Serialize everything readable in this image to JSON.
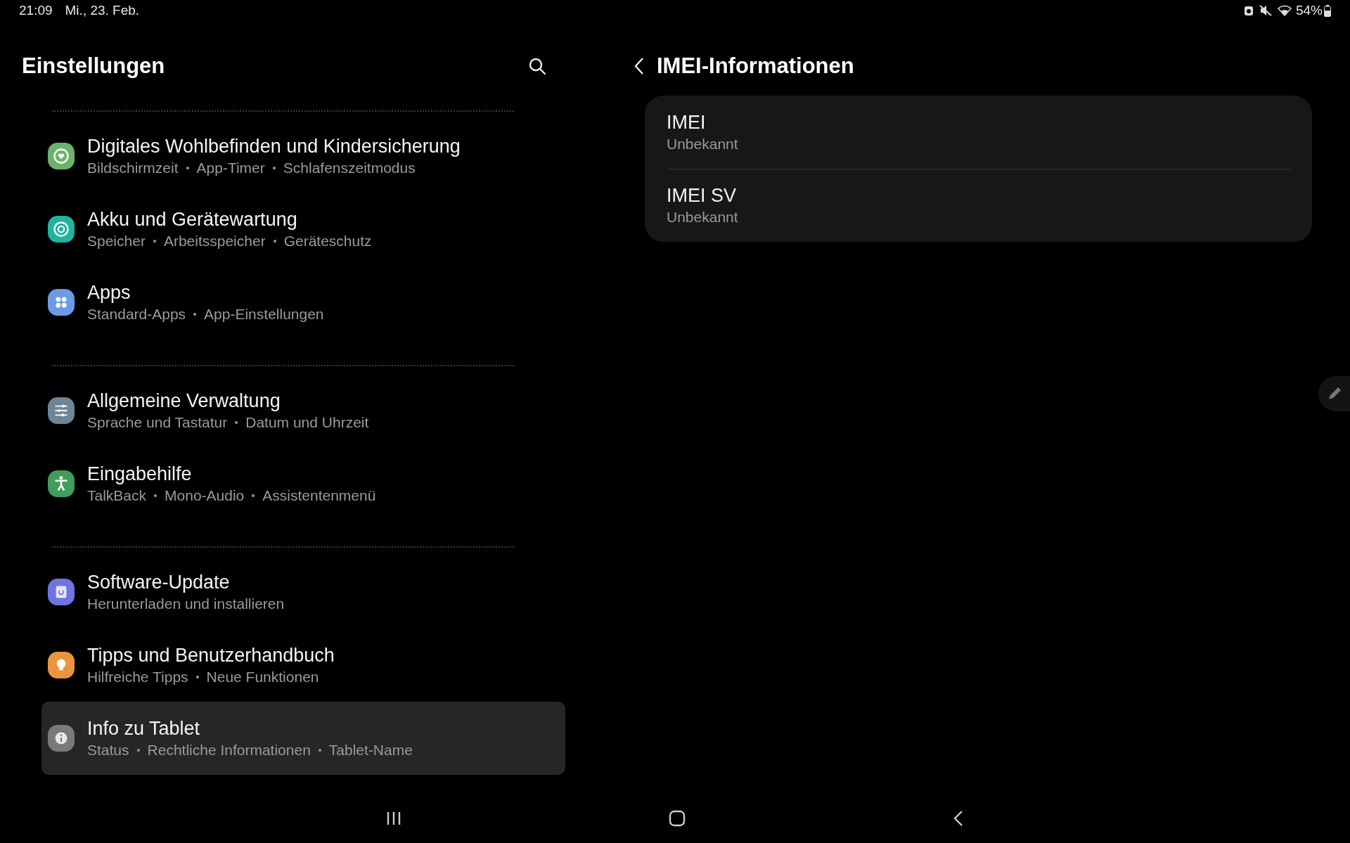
{
  "status_bar": {
    "time": "21:09",
    "date": "Mi., 23. Feb.",
    "battery": "54%"
  },
  "sidebar": {
    "title": "Einstellungen",
    "sections": [
      {
        "items": [
          {
            "title": "Digitales Wohlbefinden und Kindersicherung",
            "details": [
              "Bildschirmzeit",
              "App-Timer",
              "Schlafenszeitmodus"
            ],
            "color": "#6bb36a",
            "selected": false
          },
          {
            "title": "Akku und Gerätewartung",
            "details": [
              "Speicher",
              "Arbeitsspeicher",
              "Geräteschutz"
            ],
            "color": "#1fb3a0",
            "selected": false
          },
          {
            "title": "Apps",
            "details": [
              "Standard-Apps",
              "App-Einstellungen"
            ],
            "color": "#6b9ae6",
            "selected": false
          }
        ]
      },
      {
        "items": [
          {
            "title": "Allgemeine Verwaltung",
            "details": [
              "Sprache und Tastatur",
              "Datum und Uhrzeit"
            ],
            "color": "#6c8599",
            "selected": false
          },
          {
            "title": "Eingabehilfe",
            "details": [
              "TalkBack",
              "Mono-Audio",
              "Assistentenmenü"
            ],
            "color": "#3f9e5c",
            "selected": false
          }
        ]
      },
      {
        "items": [
          {
            "title": "Software-Update",
            "details": [
              "Herunterladen und installieren"
            ],
            "color": "#6f75e0",
            "selected": false
          },
          {
            "title": "Tipps und Benutzerhandbuch",
            "details": [
              "Hilfreiche Tipps",
              "Neue Funktionen"
            ],
            "color": "#e9953f",
            "selected": false
          },
          {
            "title": "Info zu Tablet",
            "details": [
              "Status",
              "Rechtliche Informationen",
              "Tablet-Name"
            ],
            "color": "#7a7a7a",
            "selected": true
          }
        ]
      }
    ]
  },
  "detail": {
    "title": "IMEI-Informationen",
    "rows": [
      {
        "label": "IMEI",
        "value": "Unbekannt"
      },
      {
        "label": "IMEI SV",
        "value": "Unbekannt"
      }
    ]
  }
}
